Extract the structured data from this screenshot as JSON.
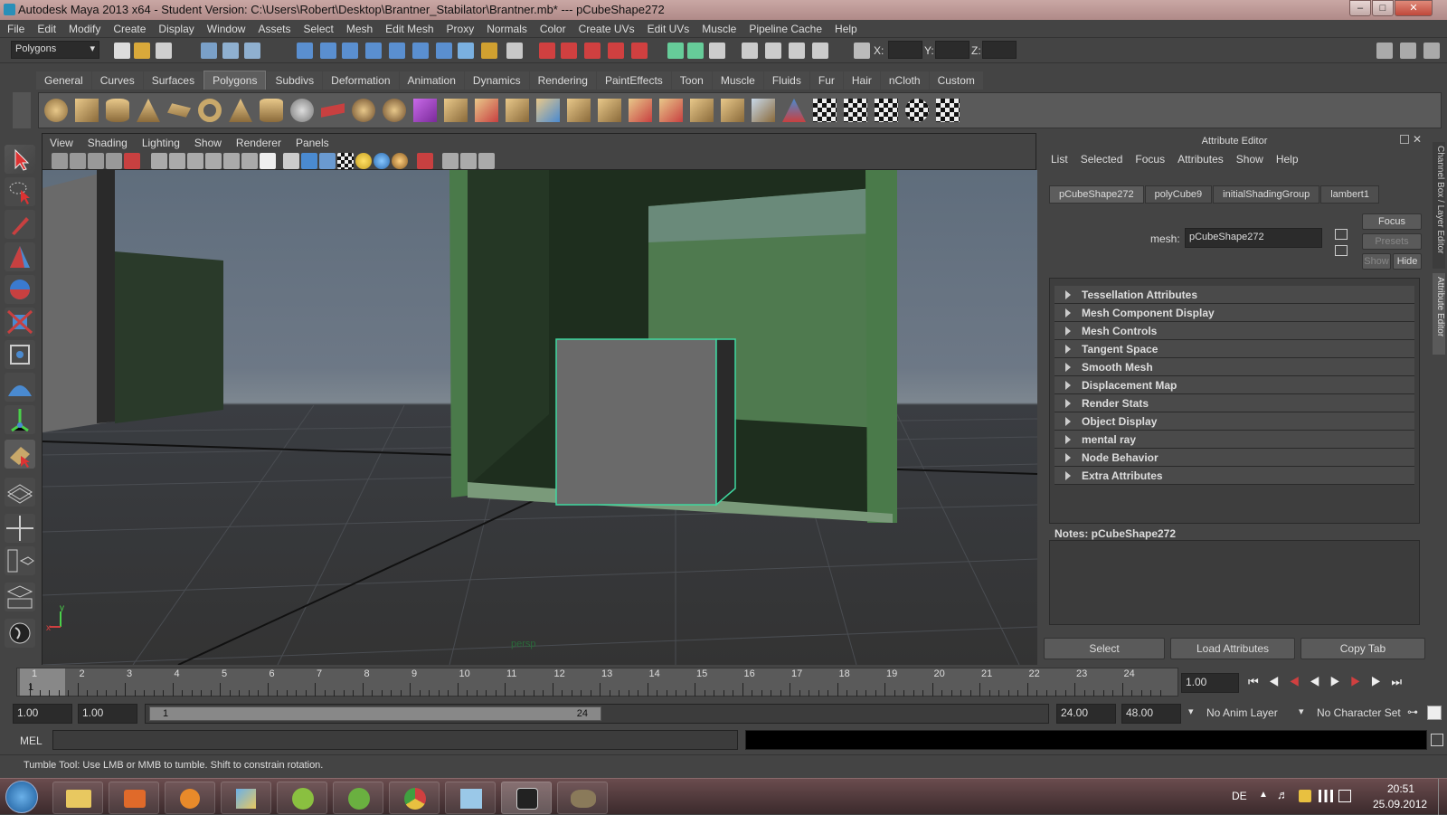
{
  "window": {
    "title": "Autodesk Maya 2013 x64 - Student Version: C:\\Users\\Robert\\Desktop\\Brantner_Stabilator\\Brantner.mb*  ---  pCubeShape272"
  },
  "menubar": [
    "File",
    "Edit",
    "Modify",
    "Create",
    "Display",
    "Window",
    "Assets",
    "Select",
    "Mesh",
    "Edit Mesh",
    "Proxy",
    "Normals",
    "Color",
    "Create UVs",
    "Edit UVs",
    "Muscle",
    "Pipeline Cache",
    "Help"
  ],
  "statusline": {
    "menuset": "Polygons",
    "x_label": "X:",
    "y_label": "Y:",
    "z_label": "Z:"
  },
  "shelf": {
    "tabs": [
      "General",
      "Curves",
      "Surfaces",
      "Polygons",
      "Subdivs",
      "Deformation",
      "Animation",
      "Dynamics",
      "Rendering",
      "PaintEffects",
      "Toon",
      "Muscle",
      "Fluids",
      "Fur",
      "Hair",
      "nCloth",
      "Custom"
    ],
    "active_tab": "Polygons"
  },
  "viewport": {
    "menu": [
      "View",
      "Shading",
      "Lighting",
      "Show",
      "Renderer",
      "Panels"
    ],
    "camera_label": "persp",
    "axis_x": "x",
    "axis_y": "y"
  },
  "attribute_editor": {
    "title": "Attribute Editor",
    "menu": [
      "List",
      "Selected",
      "Focus",
      "Attributes",
      "Show",
      "Help"
    ],
    "tabs": [
      "pCubeShape272",
      "polyCube9",
      "initialShadingGroup",
      "lambert1"
    ],
    "active_tab": "pCubeShape272",
    "mesh_label": "mesh:",
    "mesh_value": "pCubeShape272",
    "focus_button": "Focus",
    "presets_button": "Presets",
    "show_button": "Show",
    "hide_button": "Hide",
    "sections": [
      "Tessellation Attributes",
      "Mesh Component Display",
      "Mesh Controls",
      "Tangent Space",
      "Smooth Mesh",
      "Displacement Map",
      "Render Stats",
      "Object Display",
      "mental ray",
      "Node Behavior",
      "Extra Attributes"
    ],
    "notes_label": "Notes:  pCubeShape272",
    "select_button": "Select",
    "load_attributes_button": "Load Attributes",
    "copy_tab_button": "Copy Tab",
    "side_tabs": [
      "Channel Box / Layer Editor",
      "Attribute Editor"
    ]
  },
  "timeslider": {
    "frames": [
      "1",
      "2",
      "3",
      "4",
      "5",
      "6",
      "7",
      "8",
      "9",
      "10",
      "11",
      "12",
      "13",
      "14",
      "15",
      "16",
      "17",
      "18",
      "19",
      "20",
      "21",
      "22",
      "23",
      "24"
    ],
    "current_frame_label": "1",
    "current_time": "1.00"
  },
  "rangeslider": {
    "start_time": "1.00",
    "playback_start": "1.00",
    "range_start": "1",
    "range_end": "24",
    "playback_end": "24.00",
    "end_time": "48.00",
    "anim_layer": "No Anim Layer",
    "character_set": "No Character Set"
  },
  "cmdline": {
    "label": "MEL"
  },
  "helpline": {
    "text": "Tumble Tool: Use LMB or MMB to tumble. Shift to constrain rotation."
  },
  "taskbar": {
    "language": "DE",
    "time": "20:51",
    "date": "25.09.2012"
  },
  "colors": {
    "accent_selection": "#3fd8a0",
    "wall_green": "#4f7a4f",
    "viewport_bg": "#6d7886"
  }
}
